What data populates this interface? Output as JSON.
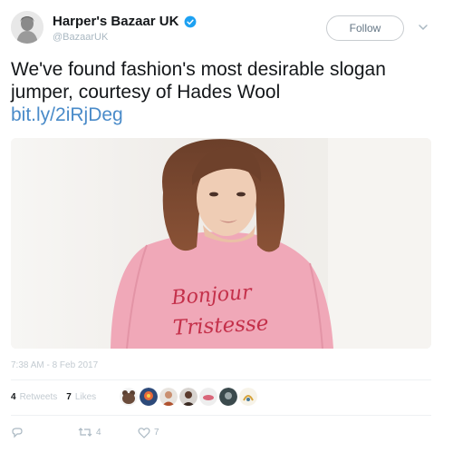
{
  "user": {
    "display_name": "Harper's Bazaar UK",
    "handle": "@BazaarUK",
    "verified": true
  },
  "follow_label": "Follow",
  "tweet": {
    "text": "We've found fashion's most desirable slogan jumper, courtesy of Hades Wool",
    "link": "bit.ly/2iRjDeg"
  },
  "photo": {
    "shirt_text_line1": "Bonjour",
    "shirt_text_line2": "Tristesse"
  },
  "timestamp": "7:38 AM - 8 Feb 2017",
  "stats": {
    "retweets_count": "4",
    "retweets_label": "Retweets",
    "likes_count": "7",
    "likes_label": "Likes"
  },
  "actions": {
    "reply_count": "",
    "retweet_count": "4",
    "like_count": "7"
  },
  "colors": {
    "link": "#4a8bc9",
    "verified": "#1da1f2",
    "muted": "#aab8c2",
    "shirt": "#f0a8b8",
    "shirt_text": "#c4304a"
  },
  "icons": {
    "avatar": "engraved-portrait",
    "verified": "verified-badge-icon",
    "caret": "chevron-down-icon",
    "reply": "reply-icon",
    "retweet": "retweet-icon",
    "like": "heart-icon"
  }
}
